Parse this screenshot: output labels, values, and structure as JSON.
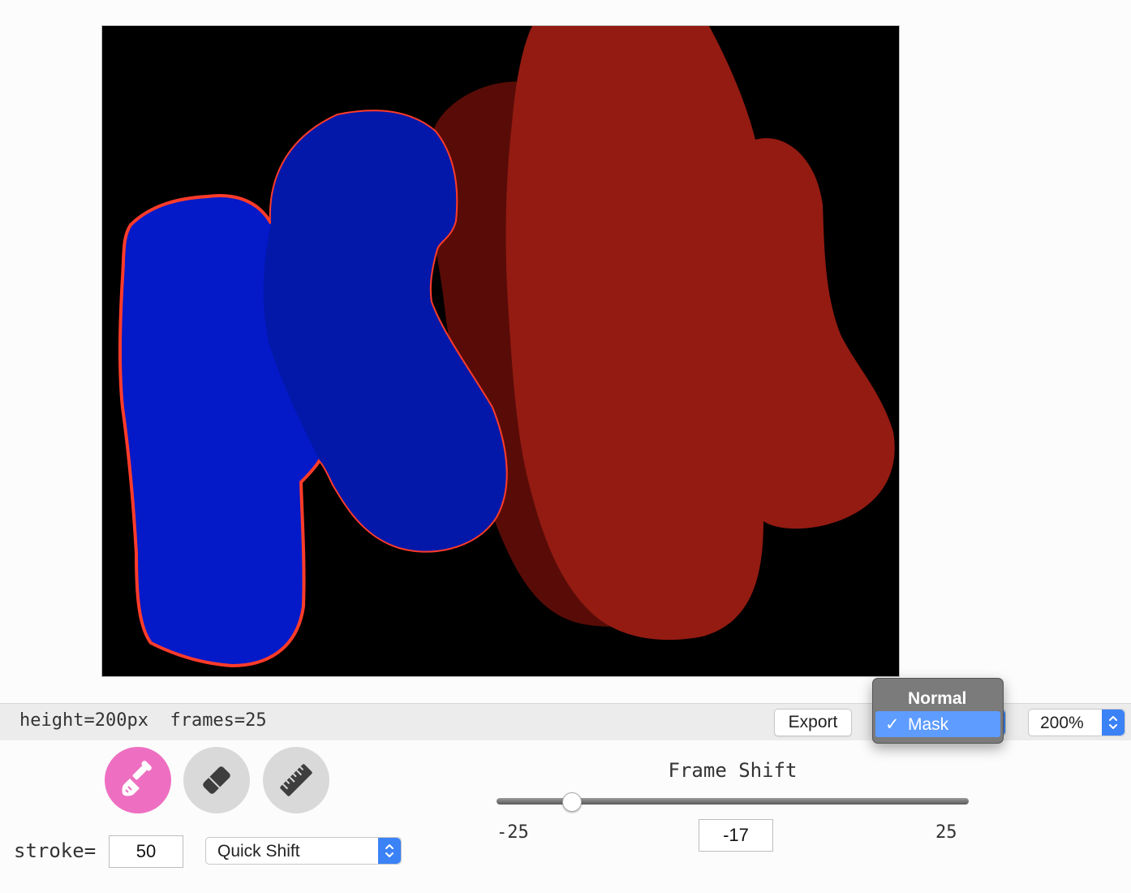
{
  "canvas": {
    "background": "#000000",
    "mask_colors": {
      "blue_light": "#0419c8",
      "blue_dark": "#0318a8",
      "red_dark": "#590c07",
      "red_main": "#931b12",
      "selection_outline": "#ff3b2a"
    }
  },
  "status_bar": {
    "height_text": "height=200px",
    "frames_text": "frames=25",
    "export_label": "Export",
    "mode_menu": {
      "options": [
        "Normal",
        "Mask"
      ],
      "selected": "Mask",
      "check_mark": "✓"
    },
    "zoom": "200%"
  },
  "tools": {
    "active": "brush",
    "items": [
      {
        "name": "brush",
        "icon": "paintbrush-icon",
        "color": "#ee6fc1"
      },
      {
        "name": "eraser",
        "icon": "eraser-icon",
        "color": "#d9d9d9"
      },
      {
        "name": "ruler",
        "icon": "ruler-icon",
        "color": "#d9d9d9"
      }
    ]
  },
  "stroke": {
    "label": "stroke=",
    "value": "50"
  },
  "method": {
    "selected": "Quick Shift"
  },
  "frame_shift": {
    "title": "Frame Shift",
    "min_label": "-25",
    "max_label": "25",
    "value": "-17",
    "min": -25,
    "max": 25,
    "current": -17
  }
}
